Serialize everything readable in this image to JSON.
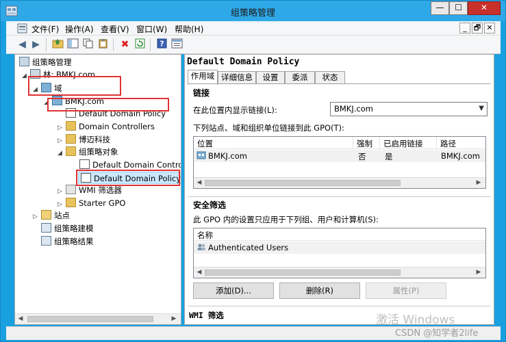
{
  "window": {
    "title": "组策略管理",
    "min_label": "—",
    "max_label": "☐",
    "close_label": "✕"
  },
  "menu": {
    "items": [
      "文件(F)",
      "操作(A)",
      "查看(V)",
      "窗口(W)",
      "帮助(H)"
    ],
    "mdi_min": "_",
    "mdi_restore": "🗗",
    "mdi_close": "✕"
  },
  "toolbar": {
    "icons": [
      "back-icon",
      "forward-icon",
      "up-folder-icon",
      "show-tree-icon",
      "copy-icon",
      "paste-icon",
      "delete-icon",
      "refresh-icon",
      "help-icon",
      "properties-icon"
    ]
  },
  "tree": {
    "root": "组策略管理",
    "forest": "林: BMKJ.com",
    "domains": "域",
    "domain": "BMKJ.com",
    "default_policy": "Default Domain Policy",
    "domain_controllers": "Domain Controllers",
    "ou": "博迈科技",
    "gpo_objects": "组策略对象",
    "gpo_ddc": "Default Domain Controll",
    "gpo_ddp": "Default Domain Policy",
    "wmi": "WMI 筛选器",
    "starter": "Starter GPO",
    "sites": "站点",
    "modeling": "组策略建模",
    "results": "组策略结果"
  },
  "detail": {
    "title": "Default Domain Policy",
    "tabs": [
      "作用域",
      "详细信息",
      "设置",
      "委派",
      "状态"
    ],
    "links_heading": "链接",
    "show_links_label": "在此位置内显示链接(L):",
    "location_value": "BMKJ.com",
    "linked_label": "下列站点、域和组织单位链接到此 GPO(T):",
    "links_columns": [
      "位置",
      "强制",
      "已启用链接",
      "路径"
    ],
    "links_rows": [
      {
        "location": "BMKJ.com",
        "enforced": "否",
        "enabled": "是",
        "path": "BMKJ.com"
      }
    ],
    "security_heading": "安全筛选",
    "security_desc": "此 GPO 内的设置只应用于下列组、用户和计算机(S):",
    "security_column": "名称",
    "security_rows": [
      "Authenticated Users"
    ],
    "add_button": "添加(D)...",
    "remove_button": "删除(R)",
    "properties_button": "属性(P)",
    "wmi_heading": "WMI 筛选"
  },
  "watermark": {
    "line1": "激活 Windows",
    "line2": "CSDN @知学者2life"
  }
}
